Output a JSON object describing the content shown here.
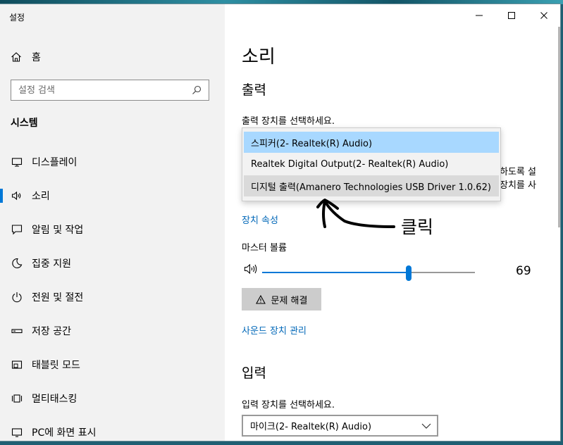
{
  "app": {
    "title": "설정"
  },
  "window_controls": {
    "minimize": "minimize",
    "maximize": "maximize",
    "close": "close"
  },
  "sidebar": {
    "home_label": "홈",
    "search_placeholder": "설정 검색",
    "section": "시스템",
    "items": [
      {
        "label": "디스플레이",
        "icon": "monitor-icon"
      },
      {
        "label": "소리",
        "icon": "speaker-icon",
        "active": true
      },
      {
        "label": "알림 및 작업",
        "icon": "notification-icon"
      },
      {
        "label": "집중 지원",
        "icon": "moon-icon"
      },
      {
        "label": "전원 및 절전",
        "icon": "power-icon"
      },
      {
        "label": "저장 공간",
        "icon": "storage-icon"
      },
      {
        "label": "태블릿 모드",
        "icon": "tablet-icon"
      },
      {
        "label": "멀티태스킹",
        "icon": "multitasking-icon"
      },
      {
        "label": "PC에 화면 표시",
        "icon": "projecting-icon"
      }
    ]
  },
  "main": {
    "title": "소리",
    "output": {
      "heading": "출력",
      "choose_label": "출력 장치를 선택하세요.",
      "options": [
        "스피커(2- Realtek(R) Audio)",
        "Realtek Digital Output(2- Realtek(R) Audio)",
        "디지털 출력(Amanero Technologies USB Driver 1.0.62)"
      ],
      "selected_index": 0,
      "hover_index": 2,
      "partial_line1": "하도록 설",
      "partial_line2": "장치를 사",
      "device_props_link": "장치 속성",
      "master_volume_label": "마스터 볼륨",
      "volume": 69,
      "troubleshoot_label": "문제 해결",
      "manage_link": "사운드 장치 관리"
    },
    "input": {
      "heading": "입력",
      "choose_label": "입력 장치를 선택하세요.",
      "selected": "마이크(2- Realtek(R) Audio)"
    }
  },
  "annotation": {
    "text": "클릭"
  },
  "colors": {
    "accent": "#0078d7",
    "link": "#0067b8",
    "selected": "#a8d8ff",
    "sidebar_bg": "#f2f2f2"
  }
}
